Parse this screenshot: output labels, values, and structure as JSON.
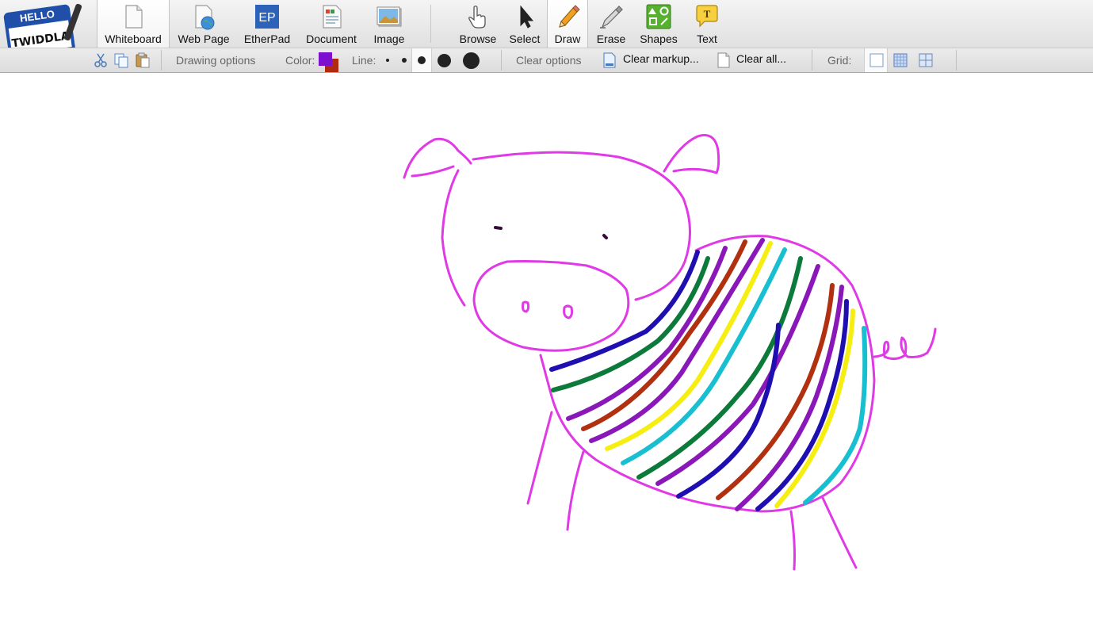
{
  "logo": {
    "line1": "HELLO",
    "line2": "TWIDDLA"
  },
  "toolbar": {
    "tabs": [
      {
        "label": "Whiteboard",
        "icon": "page-icon"
      },
      {
        "label": "Web Page",
        "icon": "web-page-globe-icon"
      },
      {
        "label": "EtherPad",
        "icon": "etherpad-icon",
        "badge": "EP"
      },
      {
        "label": "Document",
        "icon": "document-icon"
      },
      {
        "label": "Image",
        "icon": "image-icon"
      }
    ],
    "tools": [
      {
        "label": "Browse",
        "icon": "hand-pointer-icon"
      },
      {
        "label": "Select",
        "icon": "arrow-cursor-icon"
      },
      {
        "label": "Draw",
        "icon": "pencil-icon"
      },
      {
        "label": "Erase",
        "icon": "eraser-pen-icon"
      },
      {
        "label": "Shapes",
        "icon": "shapes-icon"
      },
      {
        "label": "Text",
        "icon": "text-bubble-icon",
        "badge": "T"
      }
    ],
    "active_tab": "Whiteboard",
    "active_tool": "Draw"
  },
  "options": {
    "drawing_options": "Drawing options",
    "color_label": "Color:",
    "primary_color": "#7d0fcf",
    "secondary_color": "#b02a10",
    "line_label": "Line:",
    "selected_line": 3,
    "clear_options": "Clear options",
    "clear_markup": "Clear markup...",
    "clear_all": "Clear all...",
    "grid_label": "Grid:"
  },
  "drawing": {
    "outline_color": "#e03ae6",
    "stripe_colors": [
      "#1f0fb0",
      "#0c7a3a",
      "#8a17b8",
      "#b0300f",
      "#f6ee10",
      "#18bfd0"
    ]
  }
}
